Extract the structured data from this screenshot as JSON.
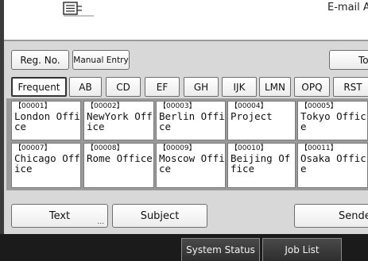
{
  "header": {
    "email_label": "E-mail A"
  },
  "toolbar": {
    "reg_no_label": "Reg. No.",
    "manual_entry_label": "Manual Entry",
    "to_label": "To"
  },
  "tabs": [
    {
      "label": "Frequent",
      "active": true
    },
    {
      "label": "AB"
    },
    {
      "label": "CD"
    },
    {
      "label": "EF"
    },
    {
      "label": "GH"
    },
    {
      "label": "IJK"
    },
    {
      "label": "LMN"
    },
    {
      "label": "OPQ"
    },
    {
      "label": "RST"
    }
  ],
  "destinations": [
    {
      "num": "【00001】",
      "name": "London Office"
    },
    {
      "num": "【00002】",
      "name": "NewYork Office"
    },
    {
      "num": "【00003】",
      "name": "Berlin Office"
    },
    {
      "num": "【00004】",
      "name": "Project"
    },
    {
      "num": "【00005】",
      "name": "Tokyo Office"
    },
    {
      "num": "【00007】",
      "name": "Chicago Office"
    },
    {
      "num": "【00008】",
      "name": "Rome Office"
    },
    {
      "num": "【00009】",
      "name": "Moscow Office"
    },
    {
      "num": "【00010】",
      "name": "Beijing Office"
    },
    {
      "num": "【00011】",
      "name": "Osaka Office"
    }
  ],
  "bottom": {
    "text_label": "Text",
    "text_dots": "...",
    "subject_label": "Subject",
    "sender_label": "Sender N"
  },
  "status": {
    "system_status_label": "System Status",
    "job_list_label": "Job List"
  }
}
